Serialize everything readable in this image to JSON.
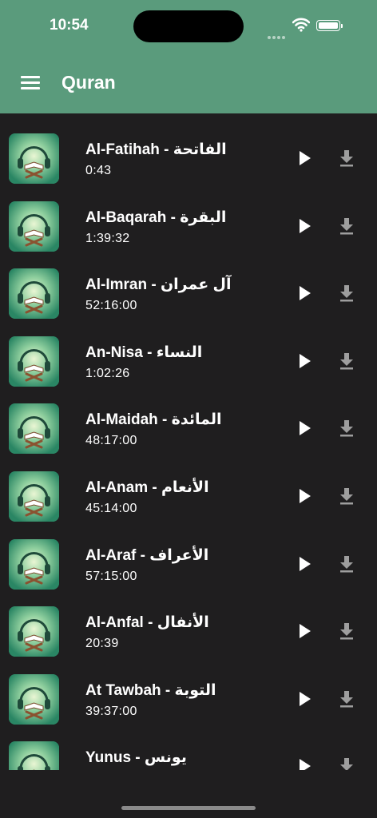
{
  "status": {
    "time": "10:54"
  },
  "header": {
    "title": "Quran"
  },
  "surahs": [
    {
      "name": "Al-Fatihah - الفاتحة",
      "duration": "0:43"
    },
    {
      "name": "Al-Baqarah - البقرة",
      "duration": "1:39:32"
    },
    {
      "name": "Al-Imran - آل عمران",
      "duration": "52:16:00"
    },
    {
      "name": "An-Nisa - النساء",
      "duration": "1:02:26"
    },
    {
      "name": "Al-Maidah - المائدة",
      "duration": "48:17:00"
    },
    {
      "name": "Al-Anam - الأنعام",
      "duration": "45:14:00"
    },
    {
      "name": "Al-Araf - الأعراف",
      "duration": "57:15:00"
    },
    {
      "name": "Al-Anfal - الأنفال",
      "duration": "20:39"
    },
    {
      "name": "At Tawbah - التوبة",
      "duration": "39:37:00"
    },
    {
      "name": "Yunus - يونس",
      "duration": ""
    }
  ],
  "icons": {
    "menu": "menu-icon",
    "play": "play-icon",
    "download": "download-icon",
    "thumbnail": "quran-headphones-icon"
  },
  "colors": {
    "appbar": "#5a9b7c",
    "background": "#1f1e1f",
    "text": "#ffffff",
    "download_icon": "#9e9e9e"
  }
}
